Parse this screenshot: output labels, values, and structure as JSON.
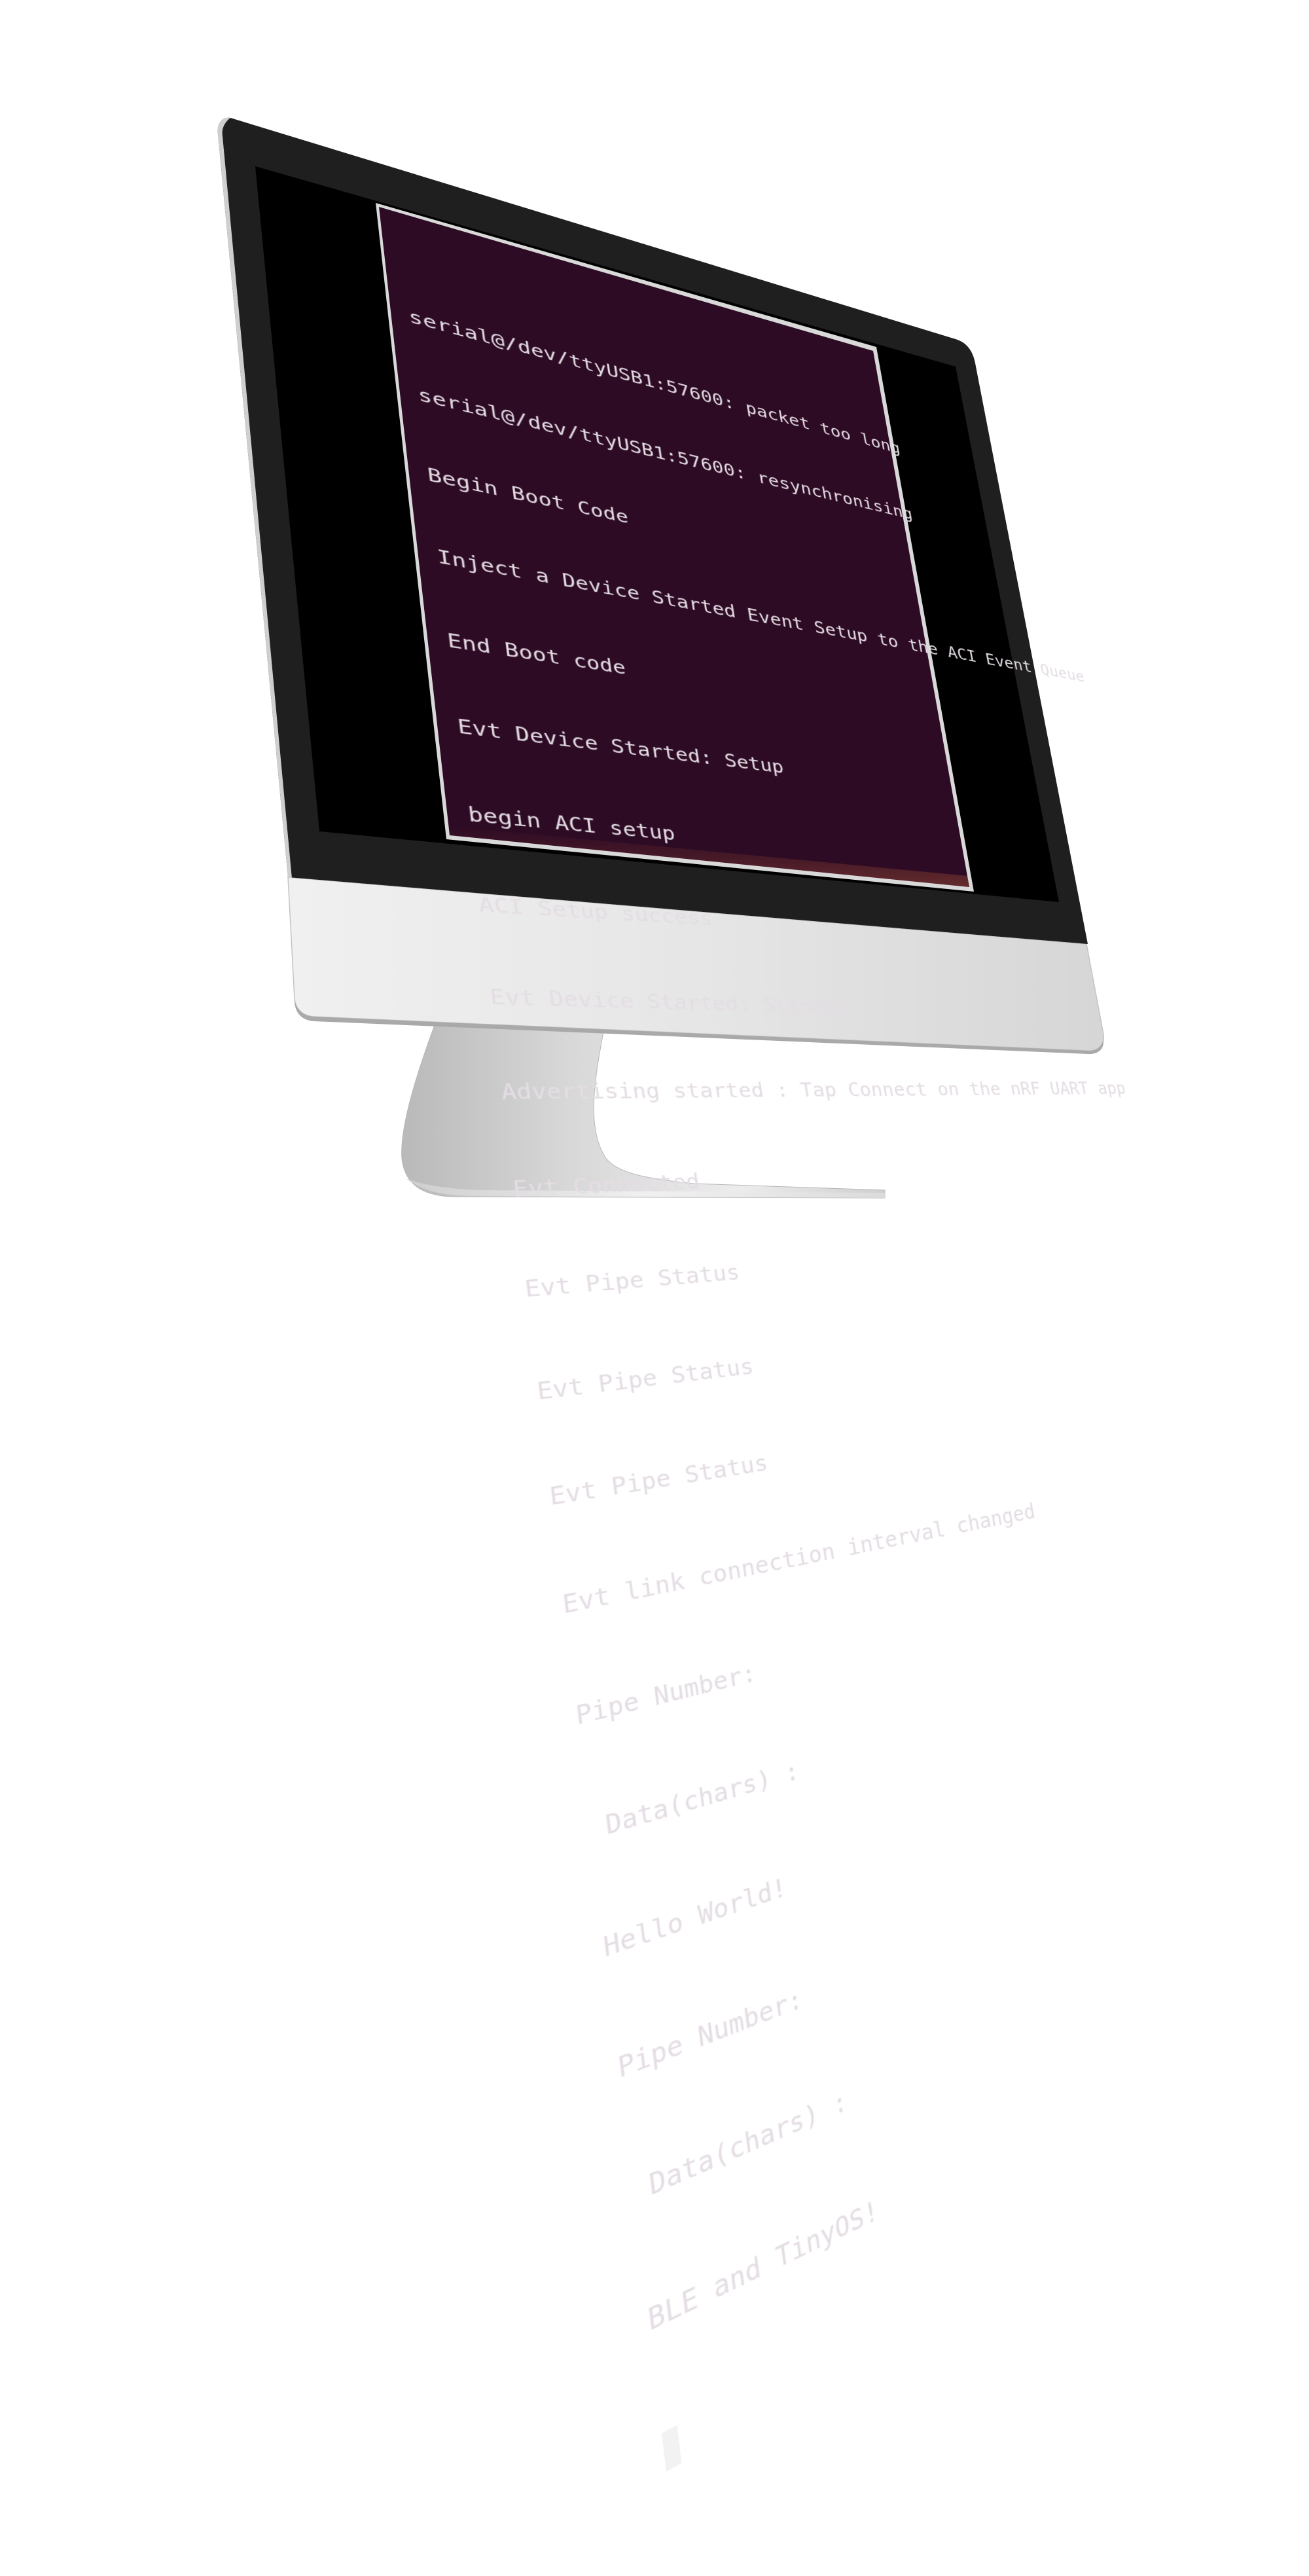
{
  "terminal": {
    "lines": [
      "serial@/dev/ttyUSB1:57600: packet too long",
      "serial@/dev/ttyUSB1:57600: resynchronising",
      "Begin Boot Code",
      "Inject a Device Started Event Setup to the ACI Event Queue",
      "End Boot code",
      "Evt Device Started: Setup",
      "begin ACI setup",
      "ACI Setup success",
      "Evt Device Started: Standby",
      "Advertising started : Tap Connect on the nRF UART app",
      "Evt Connected",
      "Evt Pipe Status",
      "Evt Pipe Status",
      "Evt Pipe Status",
      "Evt link connection interval changed",
      "Pipe Number:",
      " Data(chars) :",
      "Hello World!",
      "Pipe Number:",
      " Data(chars) :",
      "BLE and TinyOS!"
    ]
  },
  "colors": {
    "terminal_background": "#2e0b24",
    "terminal_text": "#e4dde4",
    "screen_black": "#000000",
    "bezel": "#1f1f1f",
    "chin": "#e3e3e3"
  }
}
